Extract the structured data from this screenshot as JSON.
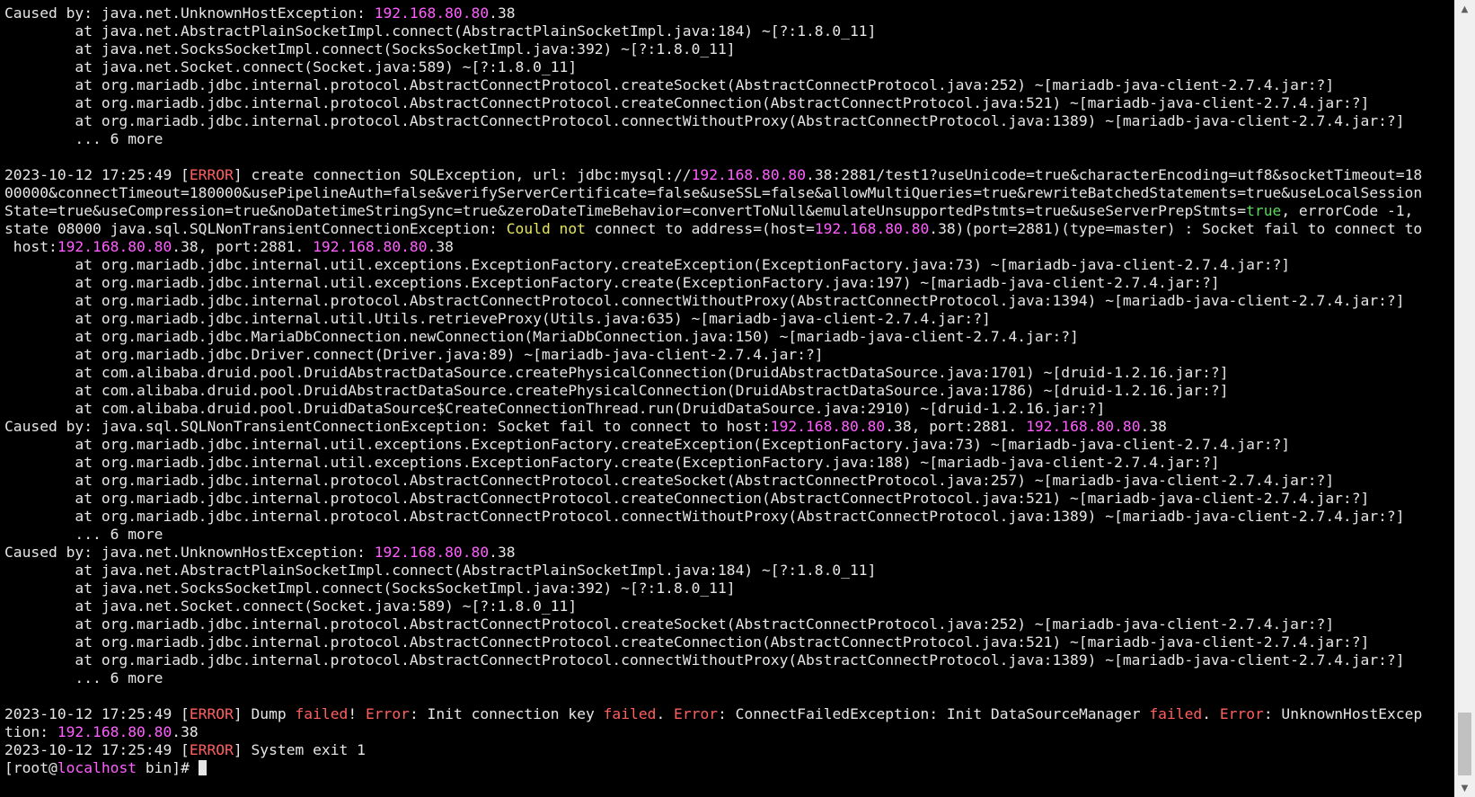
{
  "terminal": {
    "colors": {
      "normal": "#e6e6e6",
      "m": "#ff5fff",
      "r": "#ff5f5f",
      "y": "#e5e55f",
      "g": "#5fd75f"
    },
    "lines": [
      [
        [
          "n",
          "Caused by: java.net.UnknownHostException: "
        ],
        [
          "m",
          "192.168.80.80"
        ],
        [
          "n",
          ".38"
        ]
      ],
      [
        [
          "n",
          "        at java.net.AbstractPlainSocketImpl.connect(AbstractPlainSocketImpl.java:184) ~[?:1.8.0_11]"
        ]
      ],
      [
        [
          "n",
          "        at java.net.SocksSocketImpl.connect(SocksSocketImpl.java:392) ~[?:1.8.0_11]"
        ]
      ],
      [
        [
          "n",
          "        at java.net.Socket.connect(Socket.java:589) ~[?:1.8.0_11]"
        ]
      ],
      [
        [
          "n",
          "        at org.mariadb.jdbc.internal.protocol.AbstractConnectProtocol.createSocket(AbstractConnectProtocol.java:252) ~[mariadb-java-client-2.7.4.jar:?]"
        ]
      ],
      [
        [
          "n",
          "        at org.mariadb.jdbc.internal.protocol.AbstractConnectProtocol.createConnection(AbstractConnectProtocol.java:521) ~[mariadb-java-client-2.7.4.jar:?]"
        ]
      ],
      [
        [
          "n",
          "        at org.mariadb.jdbc.internal.protocol.AbstractConnectProtocol.connectWithoutProxy(AbstractConnectProtocol.java:1389) ~[mariadb-java-client-2.7.4.jar:?]"
        ]
      ],
      [
        [
          "n",
          "        ... 6 more"
        ]
      ],
      [
        [
          "n",
          ""
        ]
      ],
      [
        [
          "n",
          "2023-10-12 17:25:49 ["
        ],
        [
          "r",
          "ERROR"
        ],
        [
          "n",
          "] create connection SQLException, url: jdbc:mysql://"
        ],
        [
          "m",
          "192.168.80.80"
        ],
        [
          "n",
          ".38:2881/test1?useUnicode=true&characterEncoding=utf8&socketTimeout=18"
        ]
      ],
      [
        [
          "n",
          "00000&connectTimeout=180000&usePipelineAuth=false&verifyServerCertificate=false&useSSL=false&allowMultiQueries=true&rewriteBatchedStatements=true&useLocalSession"
        ]
      ],
      [
        [
          "n",
          "State=true&useCompression=true&noDatetimeStringSync=true&zeroDateTimeBehavior=convertToNull&emulateUnsupportedPstmts=true&useServerPrepStmts="
        ],
        [
          "g",
          "true"
        ],
        [
          "n",
          ", errorCode -1,"
        ]
      ],
      [
        [
          "n",
          "state 08000 java.sql.SQLNonTransientConnectionException: "
        ],
        [
          "y",
          "Could not"
        ],
        [
          "n",
          " connect to address=(host="
        ],
        [
          "m",
          "192.168.80.80"
        ],
        [
          "n",
          ".38)(port=2881)(type=master) : Socket fail to connect to"
        ]
      ],
      [
        [
          "n",
          " host:"
        ],
        [
          "m",
          "192.168.80.80"
        ],
        [
          "n",
          ".38, port:2881. "
        ],
        [
          "m",
          "192.168.80.80"
        ],
        [
          "n",
          ".38"
        ]
      ],
      [
        [
          "n",
          "        at org.mariadb.jdbc.internal.util.exceptions.ExceptionFactory.createException(ExceptionFactory.java:73) ~[mariadb-java-client-2.7.4.jar:?]"
        ]
      ],
      [
        [
          "n",
          "        at org.mariadb.jdbc.internal.util.exceptions.ExceptionFactory.create(ExceptionFactory.java:197) ~[mariadb-java-client-2.7.4.jar:?]"
        ]
      ],
      [
        [
          "n",
          "        at org.mariadb.jdbc.internal.protocol.AbstractConnectProtocol.connectWithoutProxy(AbstractConnectProtocol.java:1394) ~[mariadb-java-client-2.7.4.jar:?]"
        ]
      ],
      [
        [
          "n",
          "        at org.mariadb.jdbc.internal.util.Utils.retrieveProxy(Utils.java:635) ~[mariadb-java-client-2.7.4.jar:?]"
        ]
      ],
      [
        [
          "n",
          "        at org.mariadb.jdbc.MariaDbConnection.newConnection(MariaDbConnection.java:150) ~[mariadb-java-client-2.7.4.jar:?]"
        ]
      ],
      [
        [
          "n",
          "        at org.mariadb.jdbc.Driver.connect(Driver.java:89) ~[mariadb-java-client-2.7.4.jar:?]"
        ]
      ],
      [
        [
          "n",
          "        at com.alibaba.druid.pool.DruidAbstractDataSource.createPhysicalConnection(DruidAbstractDataSource.java:1701) ~[druid-1.2.16.jar:?]"
        ]
      ],
      [
        [
          "n",
          "        at com.alibaba.druid.pool.DruidAbstractDataSource.createPhysicalConnection(DruidAbstractDataSource.java:1786) ~[druid-1.2.16.jar:?]"
        ]
      ],
      [
        [
          "n",
          "        at com.alibaba.druid.pool.DruidDataSource$CreateConnectionThread.run(DruidDataSource.java:2910) ~[druid-1.2.16.jar:?]"
        ]
      ],
      [
        [
          "n",
          "Caused by: java.sql.SQLNonTransientConnectionException: Socket fail to connect to host:"
        ],
        [
          "m",
          "192.168.80.80"
        ],
        [
          "n",
          ".38, port:2881. "
        ],
        [
          "m",
          "192.168.80.80"
        ],
        [
          "n",
          ".38"
        ]
      ],
      [
        [
          "n",
          "        at org.mariadb.jdbc.internal.util.exceptions.ExceptionFactory.createException(ExceptionFactory.java:73) ~[mariadb-java-client-2.7.4.jar:?]"
        ]
      ],
      [
        [
          "n",
          "        at org.mariadb.jdbc.internal.util.exceptions.ExceptionFactory.create(ExceptionFactory.java:188) ~[mariadb-java-client-2.7.4.jar:?]"
        ]
      ],
      [
        [
          "n",
          "        at org.mariadb.jdbc.internal.protocol.AbstractConnectProtocol.createSocket(AbstractConnectProtocol.java:257) ~[mariadb-java-client-2.7.4.jar:?]"
        ]
      ],
      [
        [
          "n",
          "        at org.mariadb.jdbc.internal.protocol.AbstractConnectProtocol.createConnection(AbstractConnectProtocol.java:521) ~[mariadb-java-client-2.7.4.jar:?]"
        ]
      ],
      [
        [
          "n",
          "        at org.mariadb.jdbc.internal.protocol.AbstractConnectProtocol.connectWithoutProxy(AbstractConnectProtocol.java:1389) ~[mariadb-java-client-2.7.4.jar:?]"
        ]
      ],
      [
        [
          "n",
          "        ... 6 more"
        ]
      ],
      [
        [
          "n",
          "Caused by: java.net.UnknownHostException: "
        ],
        [
          "m",
          "192.168.80.80"
        ],
        [
          "n",
          ".38"
        ]
      ],
      [
        [
          "n",
          "        at java.net.AbstractPlainSocketImpl.connect(AbstractPlainSocketImpl.java:184) ~[?:1.8.0_11]"
        ]
      ],
      [
        [
          "n",
          "        at java.net.SocksSocketImpl.connect(SocksSocketImpl.java:392) ~[?:1.8.0_11]"
        ]
      ],
      [
        [
          "n",
          "        at java.net.Socket.connect(Socket.java:589) ~[?:1.8.0_11]"
        ]
      ],
      [
        [
          "n",
          "        at org.mariadb.jdbc.internal.protocol.AbstractConnectProtocol.createSocket(AbstractConnectProtocol.java:252) ~[mariadb-java-client-2.7.4.jar:?]"
        ]
      ],
      [
        [
          "n",
          "        at org.mariadb.jdbc.internal.protocol.AbstractConnectProtocol.createConnection(AbstractConnectProtocol.java:521) ~[mariadb-java-client-2.7.4.jar:?]"
        ]
      ],
      [
        [
          "n",
          "        at org.mariadb.jdbc.internal.protocol.AbstractConnectProtocol.connectWithoutProxy(AbstractConnectProtocol.java:1389) ~[mariadb-java-client-2.7.4.jar:?]"
        ]
      ],
      [
        [
          "n",
          "        ... 6 more"
        ]
      ],
      [
        [
          "n",
          ""
        ]
      ],
      [
        [
          "n",
          "2023-10-12 17:25:49 ["
        ],
        [
          "r",
          "ERROR"
        ],
        [
          "n",
          "] Dump "
        ],
        [
          "r",
          "failed"
        ],
        [
          "n",
          "! "
        ],
        [
          "r",
          "Error"
        ],
        [
          "n",
          ": Init connection key "
        ],
        [
          "r",
          "failed"
        ],
        [
          "n",
          ". "
        ],
        [
          "r",
          "Error"
        ],
        [
          "n",
          ": ConnectFailedException: Init DataSourceManager "
        ],
        [
          "r",
          "failed"
        ],
        [
          "n",
          ". "
        ],
        [
          "r",
          "Error"
        ],
        [
          "n",
          ": UnknownHostExcep"
        ]
      ],
      [
        [
          "n",
          "tion: "
        ],
        [
          "m",
          "192.168.80.80"
        ],
        [
          "n",
          ".38"
        ]
      ],
      [
        [
          "n",
          "2023-10-12 17:25:49 ["
        ],
        [
          "r",
          "ERROR"
        ],
        [
          "n",
          "] System exit 1"
        ]
      ],
      [
        [
          "n",
          "[root@"
        ],
        [
          "m",
          "localhost"
        ],
        [
          "n",
          " bin]# "
        ]
      ]
    ],
    "cursor_visible": true
  },
  "scrollbar": {
    "up_icon": "▲",
    "down_icon": "▼",
    "position_fraction": 1.0
  }
}
